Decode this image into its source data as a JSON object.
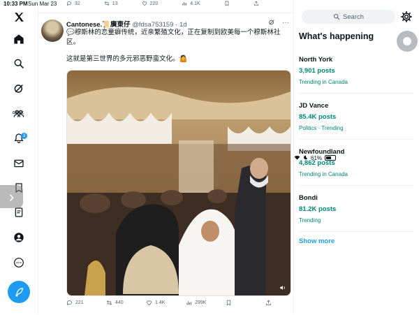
{
  "status_bar": {
    "time": "10:33 PM",
    "date": "Sun Mar 23",
    "battery": "61%"
  },
  "nav": {
    "grok_label": "GROK",
    "notification_count": "3"
  },
  "prev_tweet_actions": {
    "replies": "32",
    "reposts": "13",
    "likes": "220",
    "views": "4.1K"
  },
  "tweet": {
    "author_name": "Cantonese.📜廣東仔",
    "handle": "@fdsa753159",
    "time_ago": "1d",
    "text_line1": "💬穆斯林的恋童癖传统，近亲繁殖文化，正在复制到欧美每一个穆斯林社区。",
    "text_line2": "这就是第三世界的多元邪恶野蛮文化。🤷",
    "replies": "221",
    "reposts": "440",
    "likes": "1.4K",
    "views": "299K"
  },
  "right_column": {
    "search_placeholder": "Search",
    "section_title": "What's happening",
    "trends": [
      {
        "name": "North York",
        "posts": "3,901 posts",
        "context": "Trending in Canada"
      },
      {
        "name": "JD Vance",
        "posts": "85.4K posts",
        "context": "Politics · Trending"
      },
      {
        "name": "Newfoundland",
        "posts": "4,862 posts",
        "context": "Trending in Canada"
      },
      {
        "name": "Bondi",
        "posts": "81.2K posts",
        "context": "Trending"
      }
    ],
    "show_more": "Show more"
  },
  "colors": {
    "accent": "#1d9bf0",
    "trend_teal": "#00857a",
    "muted": "#536471"
  }
}
